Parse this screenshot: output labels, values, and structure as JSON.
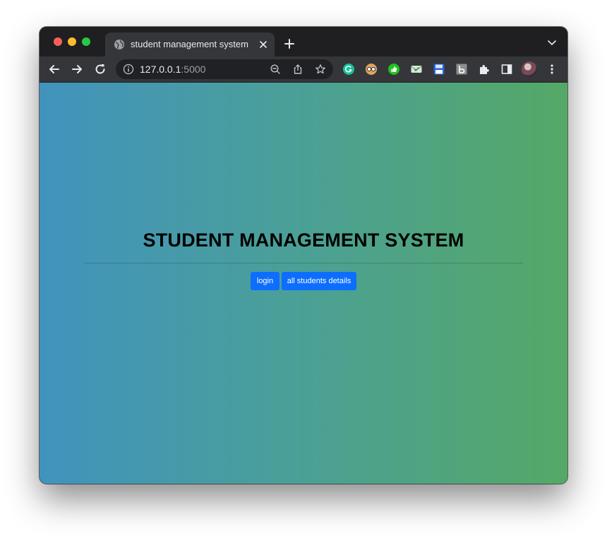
{
  "browser": {
    "tab": {
      "title": "student management system"
    },
    "address_bar": {
      "host": "127.0.0.1",
      "port": ":5000"
    },
    "icons": {
      "tab_favicon": "globe-icon",
      "tab_close": "close-icon",
      "new_tab": "plus-icon",
      "tab_search": "chevron-down-icon",
      "back": "arrow-left-icon",
      "forward": "arrow-right-icon",
      "reload": "reload-icon",
      "site_info": "info-icon",
      "zoom": "zoom-out-icon",
      "share": "share-icon",
      "bookmark": "star-icon",
      "extensions": [
        "grammarly-icon",
        "glasses-icon",
        "thumbs-up-icon",
        "mail-check-icon",
        "floppy-disk-icon",
        "bracket-icon",
        "puzzle-icon",
        "side-panel-icon"
      ],
      "menu": "kebab-menu-icon"
    },
    "colors": {
      "traffic_close": "#fe5f57",
      "traffic_minimize": "#febc2e",
      "traffic_maximize": "#28c840"
    }
  },
  "page": {
    "title": "STUDENT MANAGEMENT SYSTEM",
    "buttons": {
      "login": "login",
      "all_students": "all students details"
    },
    "colors": {
      "gradient_start": "#4193bd",
      "gradient_end": "#55a866",
      "button": "#0d6efd"
    }
  }
}
